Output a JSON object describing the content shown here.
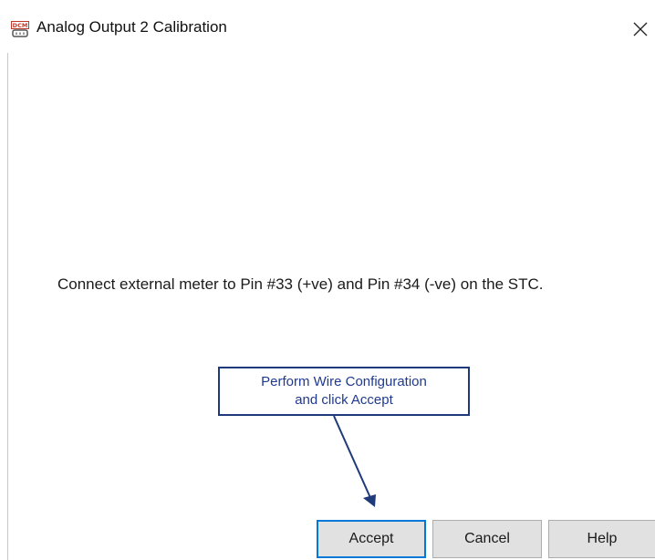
{
  "window": {
    "title": "Analog Output 2 Calibration",
    "app_icon": "dcm-app-icon",
    "close_icon": "close-icon"
  },
  "message": "Connect external meter to Pin #33 (+ve) and Pin #34 (-ve) on the STC.",
  "callout": {
    "line1": "Perform Wire Configuration",
    "line2": "and click Accept",
    "color": "#1f3a8f"
  },
  "buttons": {
    "accept": "Accept",
    "cancel": "Cancel",
    "help": "Help"
  },
  "colors": {
    "focus_border": "#0078d7",
    "button_bg": "#e1e1e1"
  }
}
